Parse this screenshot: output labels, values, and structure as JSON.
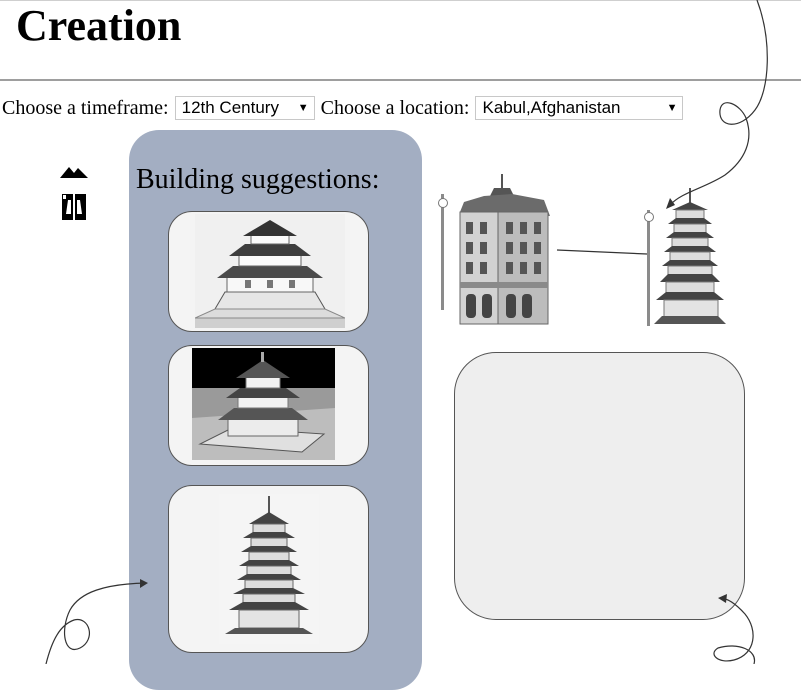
{
  "page": {
    "title": "Creation"
  },
  "controls": {
    "timeframe_label": "Choose a timeframe:",
    "timeframe_value": "12th Century",
    "location_label": "Choose a location:",
    "location_value": "Kabul,Afghanistan"
  },
  "tools": [
    {
      "icon": "mountain-icon"
    },
    {
      "icon": "flip-icon"
    }
  ],
  "suggestions": {
    "heading": "Building suggestions:",
    "items": [
      {
        "icon": "japanese-castle-icon"
      },
      {
        "icon": "pagoda-temple-icon"
      },
      {
        "icon": "tall-pagoda-icon"
      }
    ]
  },
  "canvas": {
    "buildings": [
      {
        "icon": "european-townhouse-icon"
      },
      {
        "icon": "pagoda-tower-icon"
      }
    ]
  },
  "colors": {
    "panel": "#a3aec2",
    "card": "#f4f4f4",
    "preview": "#eeeeee"
  }
}
